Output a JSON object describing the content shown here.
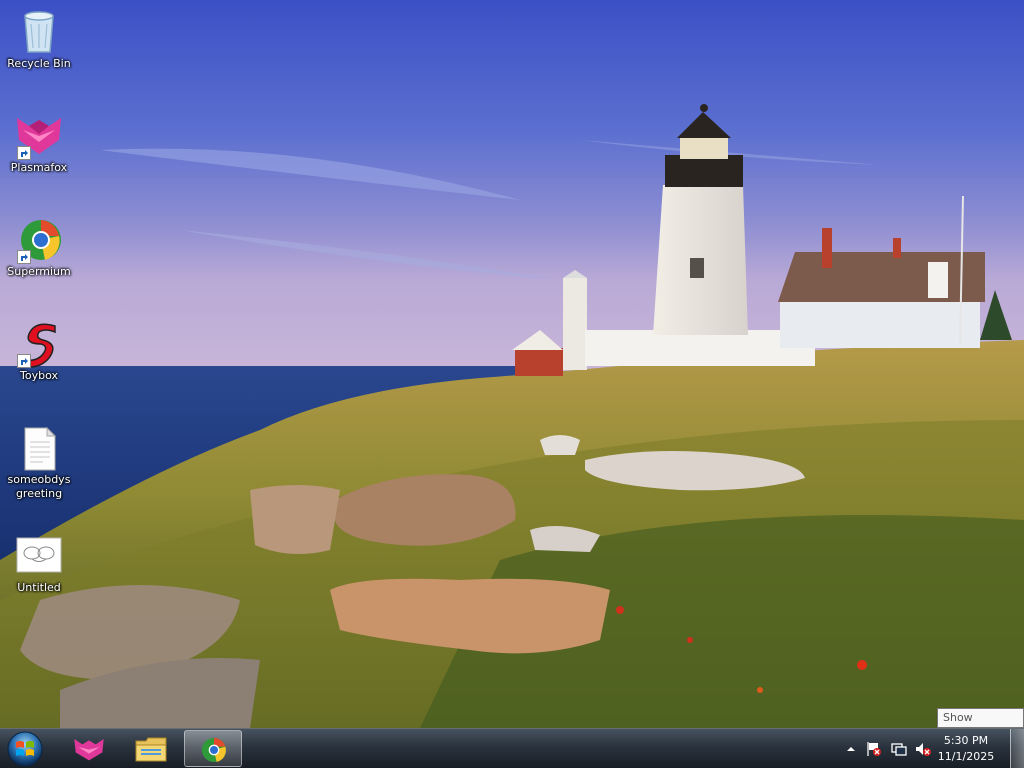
{
  "desktop": {
    "wallpaper": "lighthouse-coast",
    "icons": [
      {
        "label": "Recycle Bin",
        "icon": "recycle-bin-icon"
      },
      {
        "label": "Plasmafox",
        "icon": "plasmafox-icon"
      },
      {
        "label": "Supermium",
        "icon": "supermium-icon"
      },
      {
        "label": "Toybox",
        "icon": "toybox-icon"
      },
      {
        "label": "someobdys greeting",
        "icon": "text-file-icon"
      },
      {
        "label": "Untitled",
        "icon": "image-file-icon"
      }
    ]
  },
  "tooltip": {
    "text": "Show desktop"
  },
  "taskbar": {
    "start": {
      "icon": "windows-start-icon"
    },
    "pinned": [
      {
        "icon": "plasmafox-icon",
        "active": false
      },
      {
        "icon": "file-explorer-icon",
        "active": false
      },
      {
        "icon": "supermium-icon",
        "active": true
      }
    ],
    "tray": {
      "icons": [
        "show-hidden-icons-chevron",
        "action-center-flag-icon",
        "network-icon",
        "volume-muted-icon"
      ],
      "time": "5:30 PM",
      "date": "11/1/2025"
    }
  },
  "colors": {
    "sky_top": "#3f55c8",
    "sea": "#1f3c86",
    "grass": "#8a8a2a",
    "toybox_red": "#e01020",
    "plasmafox_pink": "#e0389a"
  }
}
